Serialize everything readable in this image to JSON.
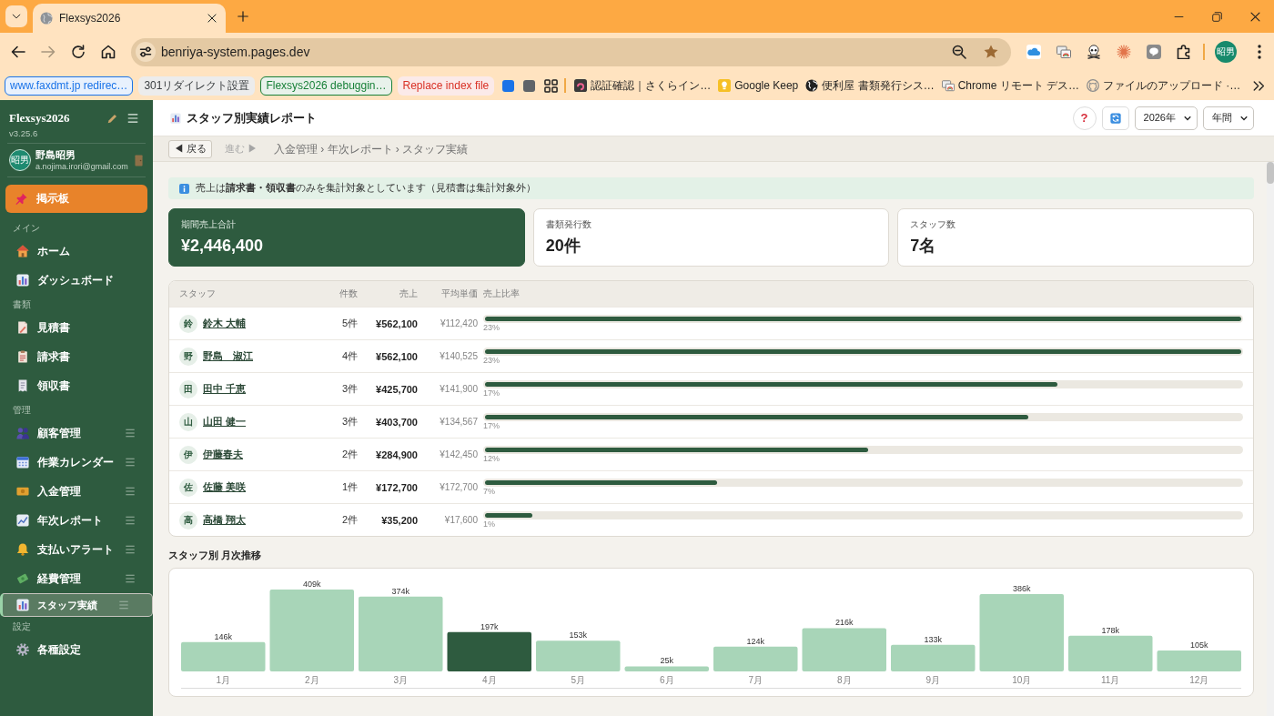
{
  "browser": {
    "tab": {
      "title": "Flexsys2026"
    },
    "nav_buttons": [
      {
        "kind": "back",
        "disabled": false
      },
      {
        "kind": "forward",
        "disabled": true
      },
      {
        "kind": "reload",
        "disabled": false
      },
      {
        "kind": "home",
        "disabled": false
      }
    ],
    "address": "benriya-system.pages.dev",
    "profile": {
      "initials": "昭男"
    },
    "tab_groups": [
      {
        "kind": "chip",
        "label": "www.faxdmt.jp redirec…",
        "color": "#1a73e8",
        "open": true
      },
      {
        "kind": "chip",
        "label": "301リダイレクト設置",
        "color": "#3c4043",
        "open": false
      },
      {
        "kind": "chip",
        "label": "Flexsys2026 debuggin…",
        "color": "#188038",
        "open": true
      },
      {
        "kind": "chip",
        "label": "Replace index file",
        "color": "#d93025",
        "open": false
      },
      {
        "kind": "square",
        "color": "#1a73e8"
      },
      {
        "kind": "square",
        "color": "#5f6368"
      }
    ],
    "bookmarks": [
      "認証確認｜さくらイン…",
      "Google Keep",
      "便利屋 書類発行シス…",
      "Chrome リモート デス…",
      "ファイルのアップロード ·…"
    ]
  },
  "sidebar": {
    "brand": "Flexsys2026",
    "version": "v3.25.6",
    "user": {
      "initials": "昭男",
      "name": "野島昭男",
      "email": "a.nojima.irori@gmail.com"
    },
    "pinned": {
      "label": "掲示板"
    },
    "sections": [
      {
        "title": "メイン",
        "items": [
          {
            "label": "ホーム",
            "selected": false,
            "handle": false
          },
          {
            "label": "ダッシュボード",
            "selected": false,
            "handle": false
          }
        ]
      },
      {
        "title": "書類",
        "items": [
          {
            "label": "見積書",
            "selected": false,
            "handle": false
          },
          {
            "label": "請求書",
            "selected": false,
            "handle": false
          },
          {
            "label": "領収書",
            "selected": false,
            "handle": false
          }
        ]
      },
      {
        "title": "管理",
        "items": [
          {
            "label": "顧客管理",
            "selected": false,
            "handle": true
          },
          {
            "label": "作業カレンダー",
            "selected": false,
            "handle": true
          },
          {
            "label": "入金管理",
            "selected": false,
            "handle": true
          },
          {
            "label": "年次レポート",
            "selected": false,
            "handle": true
          },
          {
            "label": "支払いアラート",
            "selected": false,
            "handle": true
          },
          {
            "label": "経費管理",
            "selected": false,
            "handle": true
          },
          {
            "label": "スタッフ実績",
            "selected": true,
            "handle": true
          }
        ]
      },
      {
        "title": "設定",
        "items": [
          {
            "label": "各種設定",
            "selected": false,
            "handle": false
          }
        ]
      }
    ]
  },
  "page": {
    "title": "スタッフ別実績レポート",
    "help": "?",
    "year": "2026年",
    "period": "年間"
  },
  "history": [
    {
      "label": "◀ 戻る",
      "disabled": false
    },
    {
      "label": "進む ▶",
      "disabled": true
    }
  ],
  "breadcrumb": "入金管理 › 年次レポート › スタッフ実績",
  "notice": "売上は**請求書・領収書**のみを集計対象としています（見積書は集計対象外）",
  "stats": [
    {
      "label": "期間売上合計",
      "value": "¥2,446,400",
      "highlighted": true
    },
    {
      "label": "書類発行数",
      "value": "20件",
      "highlighted": false
    },
    {
      "label": "スタッフ数",
      "value": "7名",
      "highlighted": false
    }
  ],
  "table": {
    "columns": [
      "スタッフ",
      "件数",
      "売上",
      "平均単価",
      "売上比率"
    ],
    "rows": [
      {
        "initial": "鈴",
        "name": "鈴木 大輔",
        "count": "5件",
        "sales": "¥562,100",
        "average": "¥112,420",
        "level": 1,
        "share": "23%"
      },
      {
        "initial": "野",
        "name": "野島　淑江",
        "count": "4件",
        "sales": "¥562,100",
        "average": "¥140,525",
        "level": 1,
        "share": "23%"
      },
      {
        "initial": "田",
        "name": "田中 千恵",
        "count": "3件",
        "sales": "¥425,700",
        "average": "¥141,900",
        "level": 0.757,
        "share": "17%"
      },
      {
        "initial": "山",
        "name": "山田 健一",
        "count": "3件",
        "sales": "¥403,700",
        "average": "¥134,567",
        "level": 0.718,
        "share": "17%"
      },
      {
        "initial": "伊",
        "name": "伊藤春夫",
        "count": "2件",
        "sales": "¥284,900",
        "average": "¥142,450",
        "level": 0.507,
        "share": "12%"
      },
      {
        "initial": "佐",
        "name": "佐藤 美咲",
        "count": "1件",
        "sales": "¥172,700",
        "average": "¥172,700",
        "level": 0.307,
        "share": "7%"
      },
      {
        "initial": "高",
        "name": "高橋 翔太",
        "count": "2件",
        "sales": "¥35,200",
        "average": "¥17,600",
        "level": 0.063,
        "share": "1%"
      }
    ]
  },
  "monthly": {
    "chart_data": {
      "type": "bar",
      "title": "スタッフ別 月次推移",
      "categories": [
        "1月",
        "2月",
        "3月",
        "4月",
        "5月",
        "6月",
        "7月",
        "8月",
        "9月",
        "10月",
        "11月",
        "12月"
      ],
      "values": [
        146,
        409,
        374,
        197,
        153,
        25,
        124,
        216,
        133,
        386,
        178,
        105
      ],
      "value_labels": [
        "146k",
        "409k",
        "374k",
        "197k",
        "153k",
        "25k",
        "124k",
        "216k",
        "133k",
        "386k",
        "178k",
        "105k"
      ]
    },
    "bars": [
      {
        "selected": false
      },
      {
        "selected": false
      },
      {
        "selected": false
      },
      {
        "selected": true
      },
      {
        "selected": false
      },
      {
        "selected": false
      },
      {
        "selected": false
      },
      {
        "selected": false
      },
      {
        "selected": false
      },
      {
        "selected": false
      },
      {
        "selected": false
      },
      {
        "selected": false
      }
    ]
  }
}
